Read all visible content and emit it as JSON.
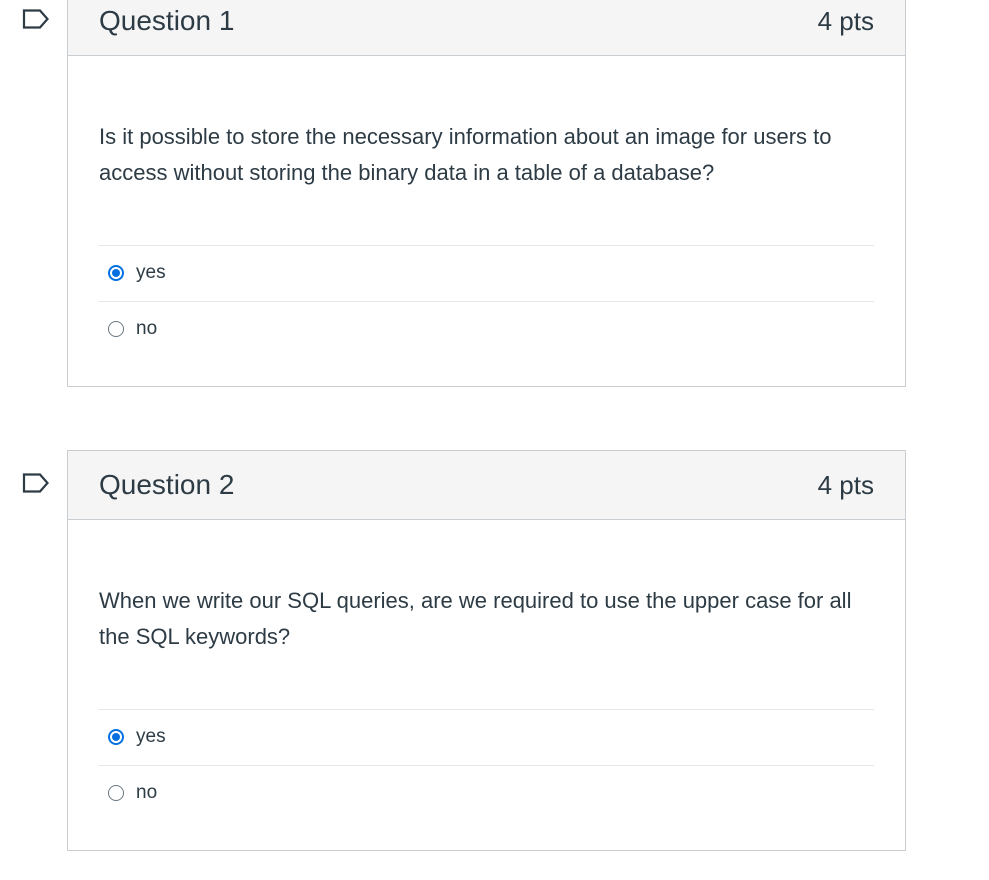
{
  "questions": [
    {
      "title": "Question 1",
      "points": "4 pts",
      "text": "Is it possible to store the necessary information about an image for users to access without storing the binary data in a table of a database?",
      "answers": [
        {
          "label": "yes",
          "selected": true
        },
        {
          "label": "no",
          "selected": false
        }
      ]
    },
    {
      "title": "Question 2",
      "points": "4 pts",
      "text": "When we write our SQL queries, are we required to use the upper case for all the SQL keywords?",
      "answers": [
        {
          "label": "yes",
          "selected": true
        },
        {
          "label": "no",
          "selected": false
        }
      ]
    }
  ],
  "colors": {
    "accent": "#0770e0",
    "header_bg": "#f5f5f5",
    "border": "#c7cdd1",
    "text": "#2d3b45"
  },
  "icons": {
    "flag": "flag-question-icon"
  }
}
